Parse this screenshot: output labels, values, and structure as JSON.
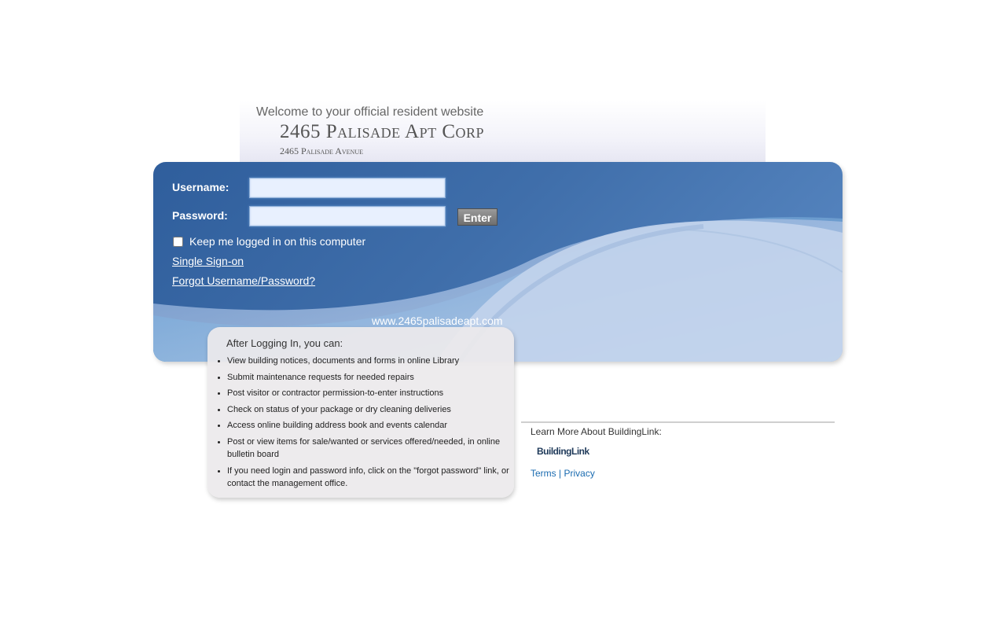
{
  "header": {
    "welcome": "Welcome to your official resident website",
    "building_name": "2465 Palisade Apt Corp",
    "building_address": "2465 Palisade Avenue"
  },
  "login": {
    "username_label": "Username:",
    "password_label": "Password:",
    "username_value": "",
    "password_value": "",
    "enter_label": "Enter",
    "keep_logged_in_label": "Keep me logged in on this computer",
    "keep_logged_in_checked": false,
    "sso_link": "Single Sign-on",
    "forgot_link": "Forgot Username/Password?",
    "website": "www.2465palisadeapt.com"
  },
  "info": {
    "title": "After Logging In, you can:",
    "items": [
      "View building notices, documents and forms in online Library",
      "Submit maintenance requests for needed repairs",
      "Post visitor or contractor permission-to-enter instructions",
      "Check on status of your package or dry cleaning deliveries",
      "Access online building address book and events calendar",
      "Post or view items for sale/wanted or services offered/needed, in online bulletin board",
      "If you need login and password info, click on the \"forgot password\" link, or contact the management office."
    ]
  },
  "right": {
    "learn_more": "Learn More About BuildingLink:",
    "logo_text": "BuildingLink",
    "terms": "Terms",
    "separator": "|",
    "privacy": "Privacy"
  },
  "colors": {
    "panel_blue": "#3f6eaa",
    "link_blue": "#1a6bb0",
    "info_bg": "#eceaec"
  }
}
